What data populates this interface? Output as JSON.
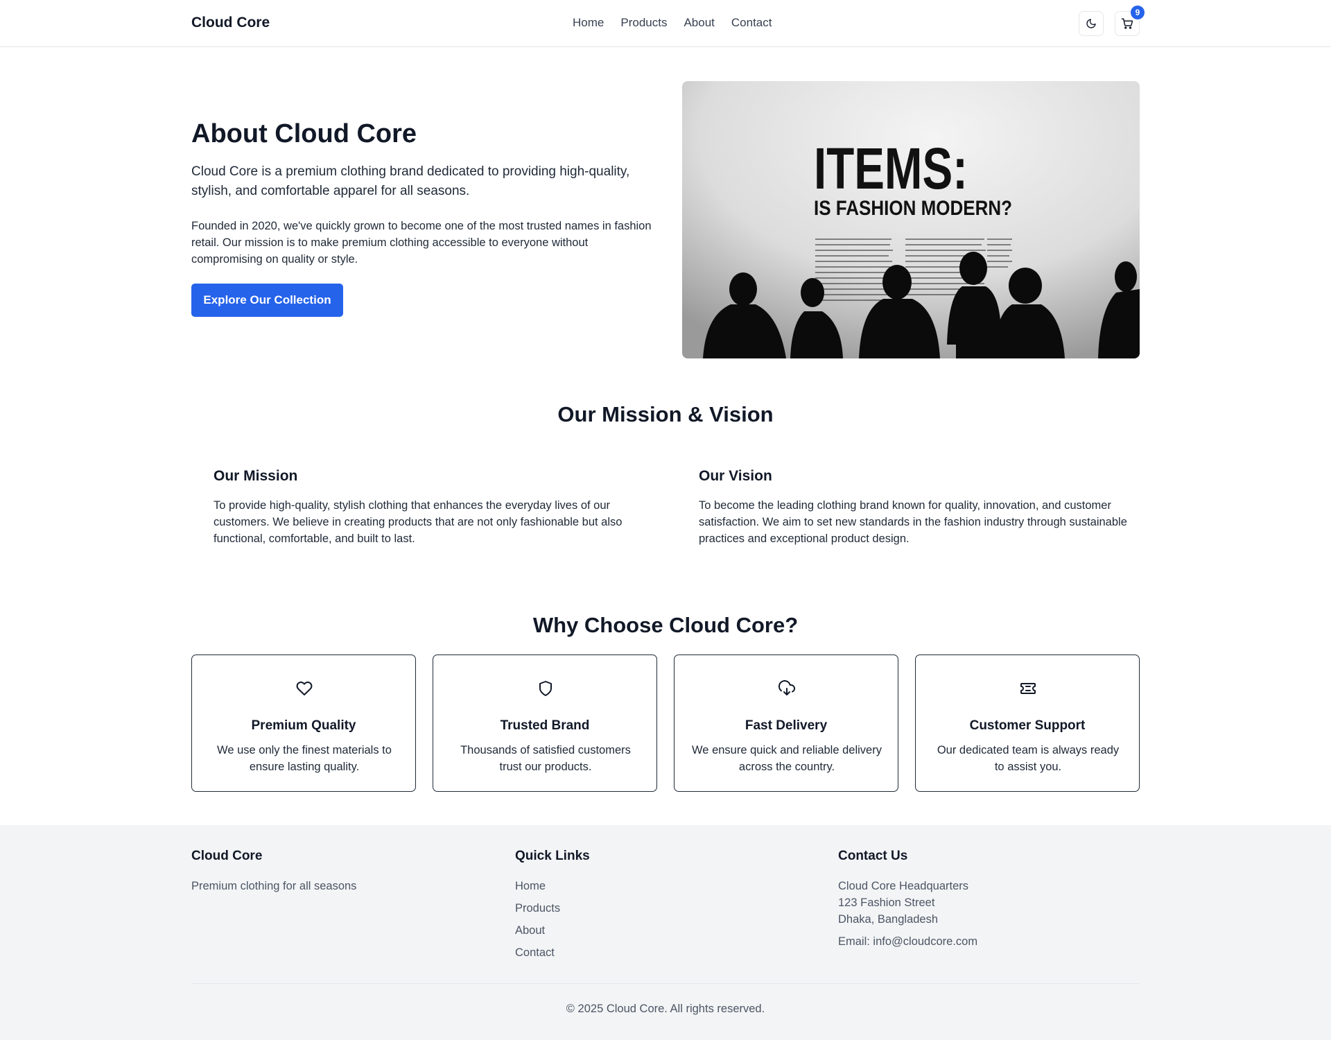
{
  "header": {
    "brand": "Cloud Core",
    "nav": [
      "Home",
      "Products",
      "About",
      "Contact"
    ],
    "cart_count": "9",
    "theme_icon": "moon-icon",
    "cart_icon": "cart-icon"
  },
  "hero": {
    "title": "About Cloud Core",
    "lead": "Cloud Core is a premium clothing brand dedicated to providing high-quality, stylish, and comfortable apparel for all seasons.",
    "body": "Founded in 2020, we've quickly grown to become one of the most trusted names in fashion retail. Our mission is to make premium clothing accessible to everyone without compromising on quality or style.",
    "cta": "Explore Our Collection",
    "image": {
      "headline": "ITEMS:",
      "subheadline": "IS FASHION MODERN?"
    }
  },
  "mission": {
    "title": "Our Mission & Vision",
    "mission_heading": "Our Mission",
    "mission_text": "To provide high-quality, stylish clothing that enhances the everyday lives of our customers. We believe in creating products that are not only fashionable but also functional, comfortable, and built to last.",
    "vision_heading": "Our Vision",
    "vision_text": "To become the leading clothing brand known for quality, innovation, and customer satisfaction. We aim to set new standards in the fashion industry through sustainable practices and exceptional product design."
  },
  "features": {
    "title": "Why Choose Cloud Core?",
    "items": [
      {
        "icon": "heart-icon",
        "title": "Premium Quality",
        "text": "We use only the finest materials to ensure lasting quality."
      },
      {
        "icon": "shield-icon",
        "title": "Trusted Brand",
        "text": "Thousands of satisfied customers trust our products."
      },
      {
        "icon": "cloud-download-icon",
        "title": "Fast Delivery",
        "text": "We ensure quick and reliable delivery across the country."
      },
      {
        "icon": "ticket-icon",
        "title": "Customer Support",
        "text": "Our dedicated team is always ready to assist you."
      }
    ]
  },
  "footer": {
    "brand": "Cloud Core",
    "tagline": "Premium clothing for all seasons",
    "links_heading": "Quick Links",
    "links": [
      "Home",
      "Products",
      "About",
      "Contact"
    ],
    "contact_heading": "Contact Us",
    "address": [
      "Cloud Core Headquarters",
      "123 Fashion Street",
      "Dhaka, Bangladesh"
    ],
    "email": "Email: info@cloudcore.com",
    "copyright": "© 2025 Cloud Core. All rights reserved."
  },
  "colors": {
    "accent": "#2563eb",
    "text": "#111827",
    "footer_bg": "#f3f4f6"
  }
}
